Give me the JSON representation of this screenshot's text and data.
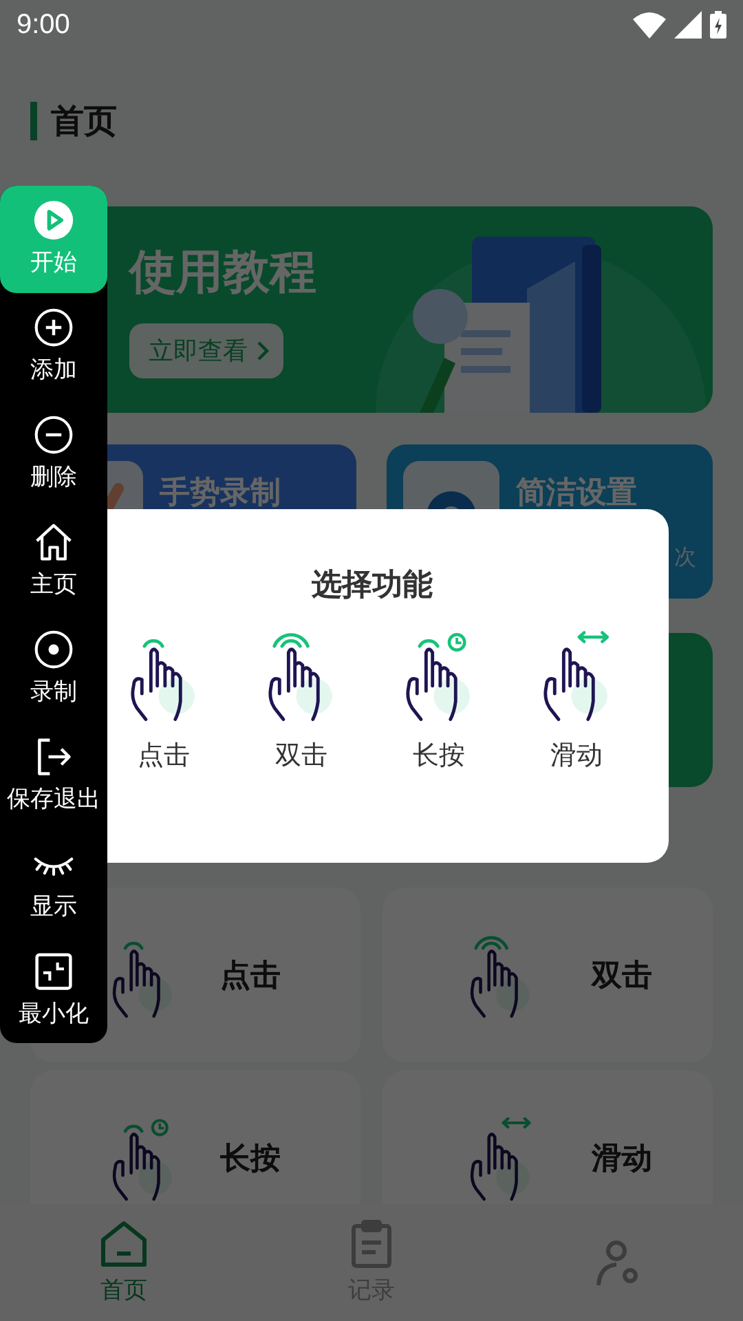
{
  "status_bar": {
    "time": "9:00"
  },
  "page_title": "首页",
  "banner": {
    "title": "使用教程",
    "button": "立即查看"
  },
  "feature_cards": [
    {
      "title": "手势录制",
      "kind": "gesture"
    },
    {
      "title": "简洁设置",
      "subtitle": "次",
      "kind": "settings"
    }
  ],
  "gesture_grid": [
    {
      "label": "点击",
      "kind": "tap"
    },
    {
      "label": "双击",
      "kind": "double"
    },
    {
      "label": "长按",
      "kind": "long"
    },
    {
      "label": "滑动",
      "kind": "swipe"
    }
  ],
  "bottom_nav": [
    {
      "label": "首页",
      "kind": "home",
      "selected": true
    },
    {
      "label": "记录",
      "kind": "record",
      "selected": false
    },
    {
      "kind": "profile",
      "selected": false
    }
  ],
  "dialog": {
    "title": "选择功能",
    "options": [
      {
        "label": "点击",
        "kind": "tap"
      },
      {
        "label": "双击",
        "kind": "double"
      },
      {
        "label": "长按",
        "kind": "long"
      },
      {
        "label": "滑动",
        "kind": "swipe"
      }
    ]
  },
  "floating_toolbar": [
    {
      "label": "开始",
      "kind": "play",
      "selected": true
    },
    {
      "label": "添加",
      "kind": "add",
      "selected": false
    },
    {
      "label": "删除",
      "kind": "remove",
      "selected": false
    },
    {
      "label": "主页",
      "kind": "home",
      "selected": false
    },
    {
      "label": "录制",
      "kind": "record",
      "selected": false
    },
    {
      "label": "保存退出",
      "kind": "exit",
      "selected": false
    },
    {
      "label": "显示",
      "kind": "eye",
      "selected": false
    },
    {
      "label": "最小化",
      "kind": "minimize",
      "selected": false
    }
  ]
}
